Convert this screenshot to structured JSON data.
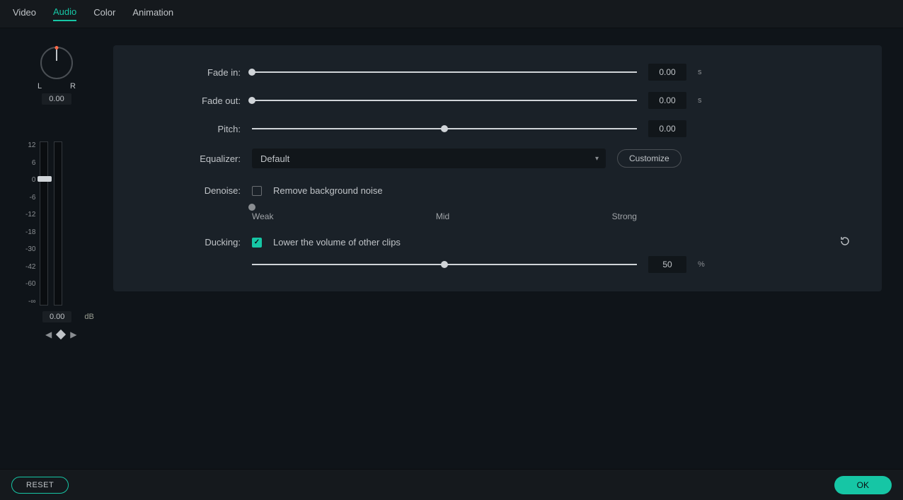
{
  "tabs": {
    "video": "Video",
    "audio": "Audio",
    "color": "Color",
    "animation": "Animation",
    "active": "audio"
  },
  "pan": {
    "L": "L",
    "R": "R",
    "value": "0.00"
  },
  "meter": {
    "scale": [
      "12",
      "6",
      "0",
      "-6",
      "-12",
      "-18",
      "-30",
      "-42",
      "-60",
      "-∞"
    ],
    "value": "0.00",
    "unit": "dB"
  },
  "fadein": {
    "label": "Fade in:",
    "value": "0.00",
    "unit": "s",
    "pos": 0
  },
  "fadeout": {
    "label": "Fade out:",
    "value": "0.00",
    "unit": "s",
    "pos": 0
  },
  "pitch": {
    "label": "Pitch:",
    "value": "0.00",
    "pos": 50
  },
  "equalizer": {
    "label": "Equalizer:",
    "selected": "Default",
    "customize": "Customize"
  },
  "denoise": {
    "label": "Denoise:",
    "checkbox_label": "Remove background noise",
    "checked": false,
    "pos": 0,
    "weak": "Weak",
    "mid": "Mid",
    "strong": "Strong"
  },
  "ducking": {
    "label": "Ducking:",
    "checkbox_label": "Lower the volume of other clips",
    "checked": true,
    "value": "50",
    "unit": "%",
    "pos": 50
  },
  "footer": {
    "reset": "RESET",
    "ok": "OK"
  }
}
